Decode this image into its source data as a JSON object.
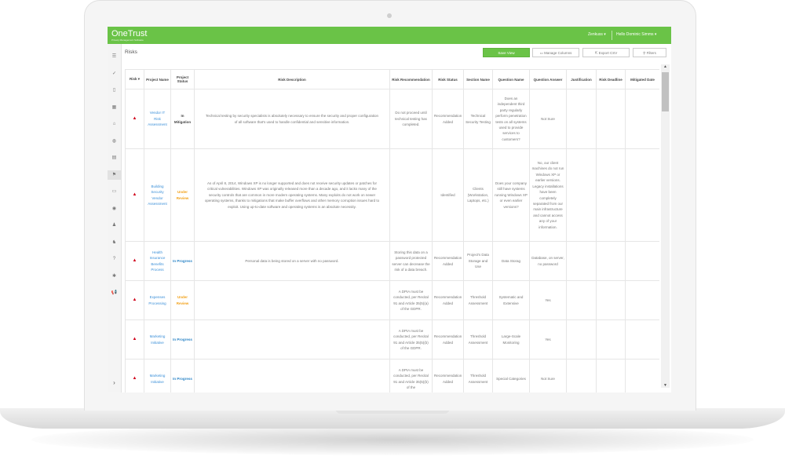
{
  "app": {
    "logo": "OneTrust",
    "logo_sub": "Privacy Management Software"
  },
  "topbar": {
    "org": "Zenkuss ▾",
    "user": "Hello Dominic Simms ▾"
  },
  "sidebar": {
    "icons": [
      "menu-icon",
      "check-icon",
      "document-icon",
      "grid-icon",
      "bank-icon",
      "globe-icon",
      "table-icon",
      "flag-icon",
      "folder-icon",
      "eye-icon",
      "user-icon",
      "users-icon",
      "question-icon",
      "gear-icon",
      "megaphone-icon"
    ],
    "active_index": 7,
    "highlight_index": 14
  },
  "page": {
    "title": "Risks"
  },
  "toolbar": {
    "save_view": "Save View",
    "manage_columns": "Manage Columns",
    "export_csv": "Export CSV",
    "filters": "Filters"
  },
  "table": {
    "headers": [
      "Risk ▾",
      "Project Name",
      "Project Status",
      "Risk Description",
      "Risk Recommendation",
      "Risk Status",
      "Section Name",
      "Question Name",
      "Question Answer",
      "Justification",
      "Risk Deadline",
      "Mitigated Date"
    ],
    "rows": [
      {
        "project": "Vendor IT Risk Assessment",
        "status": "In Mitigation",
        "status_type": "mit",
        "description": "Technical testing by security specialists is absolutely necessary to ensure the security and proper configuration of all software that's used to handle confidential and sensitive information.",
        "recommendation": "Do not proceed until technical testing has completed.",
        "risk_status": "Recommendation Added",
        "section": "Technical Security Testing",
        "question": "Does an independent third party regularly perform penetration tests on all systems used to provide services to customers?",
        "answer": "Not Sure",
        "justification": "",
        "deadline": "",
        "mitigated": ""
      },
      {
        "project": "Building Security Vendor Assessment",
        "status": "Under Review",
        "status_type": "rev",
        "description": "As of April 8, 2014, Windows XP is no longer supported and does not receive security updates or patches for critical vulnerabilities. Windows XP was originally released more than a decade ago, and it lacks many of the security controls that are common in more modern operating systems. Many exploits do not work on newer operating systems, thanks to mitigations that make buffer overflows and other memory corruption issues hard to exploit. Using up-to-date software and operating systems is an absolute necessity.",
        "recommendation": "",
        "risk_status": "Identified",
        "section": "Clients (Workstation, Laptops, etc.)",
        "question": "Does your company still have systems running Windows XP or even earlier versions?",
        "answer": "No, our client machines do not run Windows XP or earlier versions. Legacy installations have been completely separated from our main infrastructure and cannot access any of your information.",
        "justification": "",
        "deadline": "",
        "mitigated": ""
      },
      {
        "project": "Health Insurance Benefits Process",
        "status": "In Progress",
        "status_type": "prog",
        "description": "Personal data is being stored on a server with no password.",
        "recommendation": "Storing this data on a password protected server can decrease the risk of a data breach.",
        "risk_status": "Recommendation Added",
        "section": "Project's Data Storage and Use",
        "question": "Data Storag",
        "answer": "Database, on server, no password",
        "justification": "",
        "deadline": "",
        "mitigated": ""
      },
      {
        "project": "Expenses Processing",
        "status": "Under Review",
        "status_type": "rev",
        "description": "",
        "recommendation": "A DPIA must be conducted, per Recital 91 and Article 35(5)(a) of the GDPR.",
        "risk_status": "Recommendation Added",
        "section": "Threshold Assessment",
        "question": "Systematic and Extensive",
        "answer": "Yes",
        "justification": "",
        "deadline": "",
        "mitigated": ""
      },
      {
        "project": "Marketing Initiative",
        "status": "In Progress",
        "status_type": "prog",
        "description": "",
        "recommendation": "A DPIA must be conducted, per Recital 91 and Article 35(5)(b) of the GDPR.",
        "risk_status": "Recommendation Added",
        "section": "Threshold Assessment",
        "question": "Large-Scale Monitoring",
        "answer": "Yes",
        "justification": "",
        "deadline": "",
        "mitigated": ""
      },
      {
        "project": "Marketing Initiative",
        "status": "In Progress",
        "status_type": "prog",
        "description": "",
        "recommendation": "A DPIA must be conducted, per Recital 91 and Article 35(5)(b) of the",
        "risk_status": "Recommendation Added",
        "section": "Threshold Assessment",
        "question": "Special Categories",
        "answer": "Not Sure",
        "justification": "",
        "deadline": "",
        "mitigated": ""
      }
    ]
  },
  "colors": {
    "brand_green": "#6ac347",
    "link_blue": "#3a8fd8",
    "review_orange": "#f2a118",
    "risk_red": "#d0021b"
  }
}
